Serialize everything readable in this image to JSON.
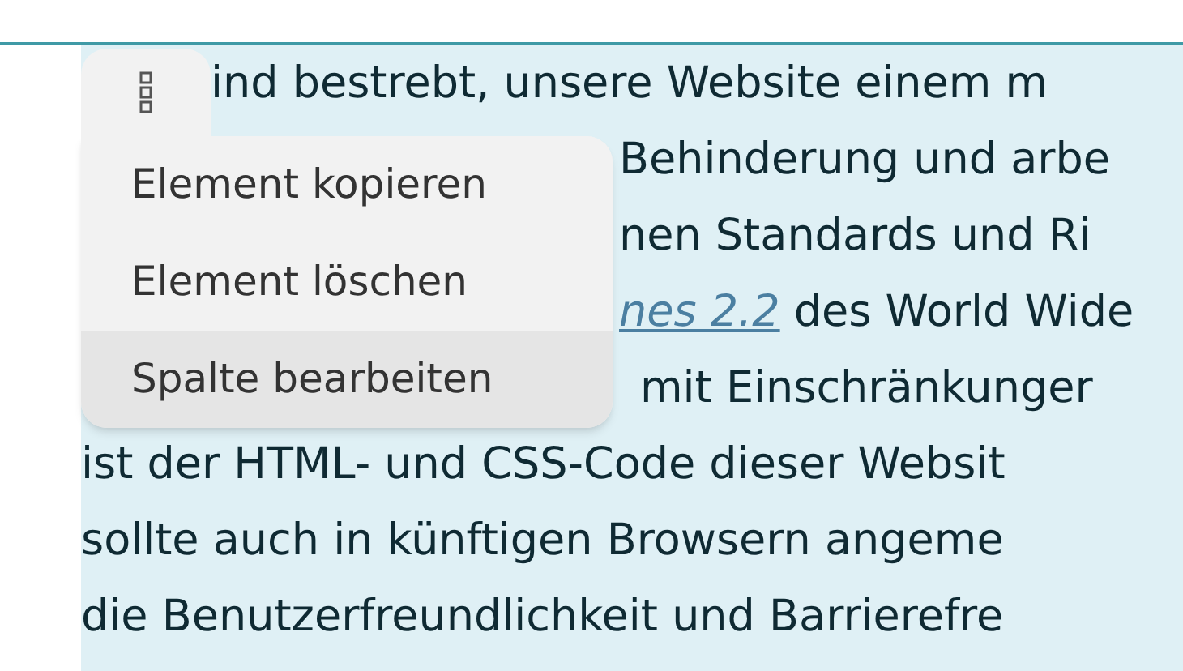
{
  "paragraph_lines": [
    {
      "parts": [
        {
          "text": "ind bestrebt, unsere Website einem m",
          "kind": "plain"
        }
      ]
    },
    {
      "parts": [
        {
          "text": "Behinderung und arbe",
          "kind": "plain"
        }
      ]
    },
    {
      "parts": [
        {
          "text": "nen Standards und Ri",
          "kind": "plain"
        }
      ]
    },
    {
      "parts": [
        {
          "text": "nes 2.2",
          "kind": "link"
        },
        {
          "text": " des World Wide",
          "kind": "plain"
        }
      ]
    },
    {
      "parts": [
        {
          "text": "mit Einschränkunger",
          "kind": "plain"
        }
      ]
    },
    {
      "parts": [
        {
          "text": "ist der HTML- und CSS-Code dieser Websit",
          "kind": "plain"
        }
      ]
    },
    {
      "parts": [
        {
          "text": "sollte auch in künftigen Browsern angeme",
          "kind": "plain"
        }
      ]
    },
    {
      "parts": [
        {
          "text": "die Benutzerfreundlichkeit und Barrierefre",
          "kind": "plain"
        }
      ]
    }
  ],
  "context_menu": {
    "items": [
      {
        "label": "Element kopieren",
        "highlighted": false
      },
      {
        "label": "Element löschen",
        "highlighted": false
      },
      {
        "label": "Spalte bearbeiten",
        "highlighted": true
      }
    ]
  }
}
